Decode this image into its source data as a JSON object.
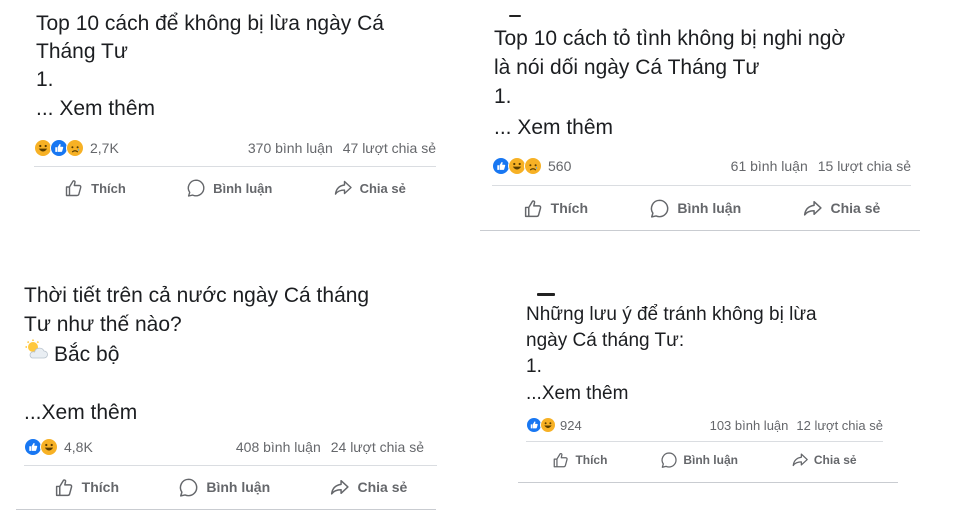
{
  "posts": [
    {
      "text": "Top 10 cách để không bị lừa ngày Cá\nTháng Tư\n1.",
      "see_more": "... Xem thêm",
      "reactions": [
        "haha",
        "like",
        "sad"
      ],
      "reaction_count": "2,7K",
      "comments": "370 bình luận",
      "shares": "47 lượt chia sẻ",
      "actions": {
        "like": "Thích",
        "comment": "Bình luận",
        "share": "Chia sẻ"
      }
    },
    {
      "text": "Top 10 cách tỏ tình không bị nghi ngờ\nlà nói dối ngày Cá Tháng Tư\n1.",
      "see_more": "... Xem thêm",
      "reactions": [
        "like",
        "haha",
        "sad"
      ],
      "reaction_count": "560",
      "comments": "61 bình luận",
      "shares": "15 lượt chia sẻ",
      "actions": {
        "like": "Thích",
        "comment": "Bình luận",
        "share": "Chia sẻ"
      }
    },
    {
      "text": "Thời tiết trên cả nước ngày Cá tháng\nTư như thế nào?",
      "weather_line": "Bắc bộ",
      "weather_icon": "sun-behind-cloud-icon",
      "see_more": "...Xem thêm",
      "reactions": [
        "like",
        "haha"
      ],
      "reaction_count": "4,8K",
      "comments": "408 bình luận",
      "shares": "24 lượt chia sẻ",
      "actions": {
        "like": "Thích",
        "comment": "Bình luận",
        "share": "Chia sẻ"
      }
    },
    {
      "text": "Những lưu ý để tránh không bị lừa\nngày Cá tháng Tư:\n1.",
      "see_more": "...Xem thêm",
      "reactions": [
        "like",
        "haha"
      ],
      "reaction_count": "924",
      "comments": "103 bình luận",
      "shares": "12 lượt chia sẻ",
      "actions": {
        "like": "Thích",
        "comment": "Bình luận",
        "share": "Chia sẻ"
      }
    }
  ],
  "colors": {
    "like": "#1877f2",
    "haha": "#f7b125",
    "text": "#1c1e21",
    "muted": "#65676b",
    "divider": "#dadde1"
  }
}
